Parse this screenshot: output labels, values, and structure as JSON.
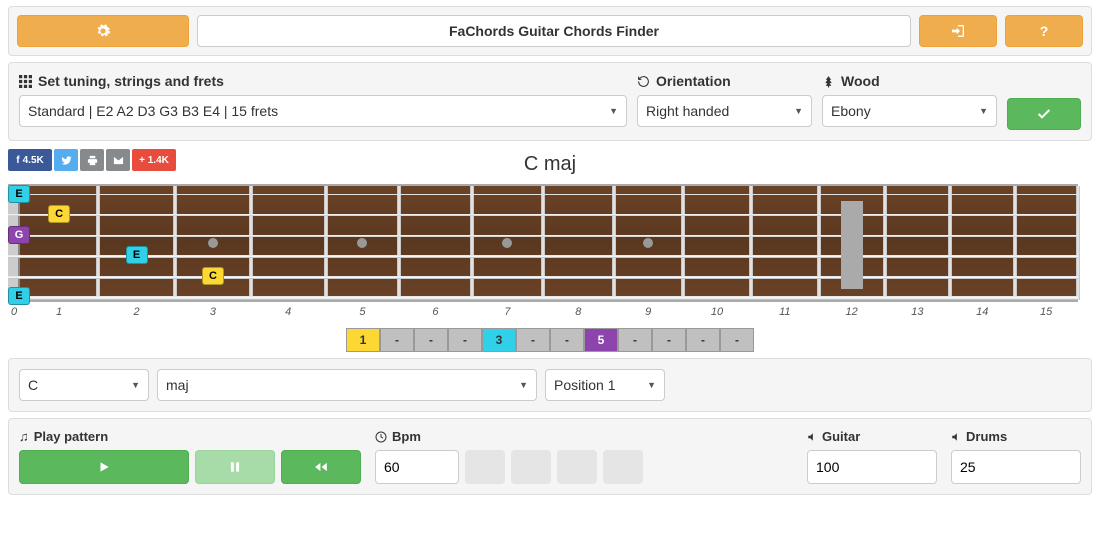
{
  "header": {
    "title": "FaChords Guitar Chords Finder"
  },
  "settings": {
    "tuning_label": "Set tuning, strings and frets",
    "orientation_label": "Orientation",
    "wood_label": "Wood",
    "tuning_value": "Standard | E2 A2 D3 G3 B3 E4 | 15 frets",
    "orientation_value": "Right handed",
    "wood_value": "Ebony"
  },
  "social": {
    "fb_count": "4.5K",
    "plus_count": "+ 1.4K"
  },
  "chord": {
    "name": "C maj",
    "root": "C",
    "type": "maj",
    "position": "Position 1"
  },
  "fretboard": {
    "fret_count": 15,
    "fret_numbers": [
      "0",
      "1",
      "2",
      "3",
      "4",
      "5",
      "6",
      "7",
      "8",
      "9",
      "10",
      "11",
      "12",
      "13",
      "14",
      "15"
    ],
    "open_notes": [
      {
        "string": 1,
        "label": "E",
        "color": "cyan"
      },
      {
        "string": 3,
        "label": "G",
        "color": "purple"
      },
      {
        "string": 6,
        "label": "E",
        "color": "cyan"
      }
    ],
    "fretted_notes": [
      {
        "string": 2,
        "fret": 1,
        "label": "C",
        "color": "yellow"
      },
      {
        "string": 4,
        "fret": 2,
        "label": "E",
        "color": "cyan"
      },
      {
        "string": 5,
        "fret": 3,
        "label": "C",
        "color": "yellow"
      }
    ],
    "inlay_frets": [
      3,
      5,
      7,
      9
    ],
    "double_inlay_fret": 12
  },
  "intervals": [
    {
      "label": "1",
      "color": "yellow"
    },
    {
      "label": "-",
      "color": "grey"
    },
    {
      "label": "-",
      "color": "grey"
    },
    {
      "label": "-",
      "color": "grey"
    },
    {
      "label": "3",
      "color": "cyan"
    },
    {
      "label": "-",
      "color": "grey"
    },
    {
      "label": "-",
      "color": "grey"
    },
    {
      "label": "5",
      "color": "purple"
    },
    {
      "label": "-",
      "color": "grey"
    },
    {
      "label": "-",
      "color": "grey"
    },
    {
      "label": "-",
      "color": "grey"
    },
    {
      "label": "-",
      "color": "grey"
    }
  ],
  "play": {
    "pattern_label": "Play pattern",
    "bpm_label": "Bpm",
    "bpm_value": "60",
    "guitar_label": "Guitar",
    "guitar_value": "100",
    "drums_label": "Drums",
    "drums_value": "25"
  }
}
